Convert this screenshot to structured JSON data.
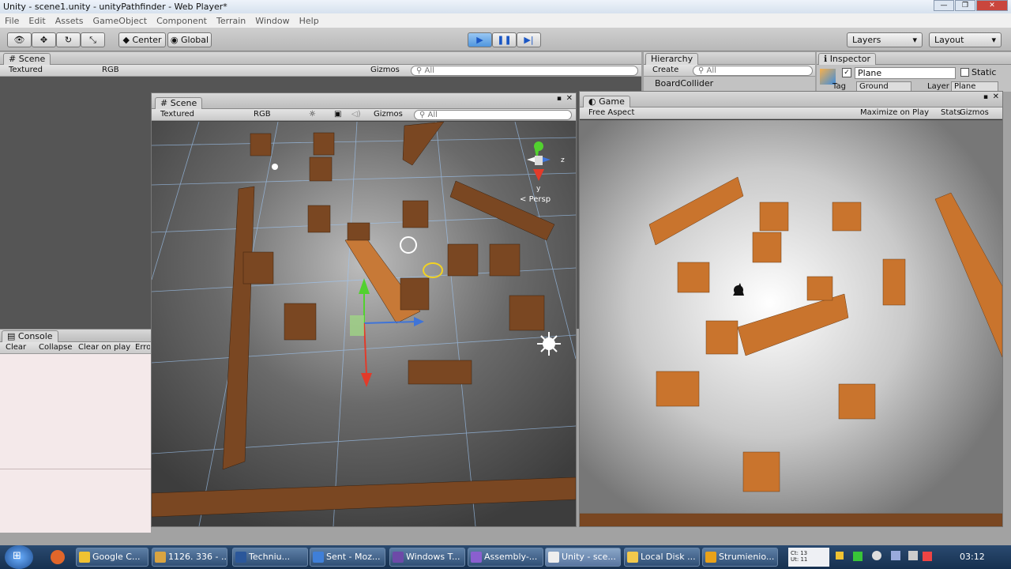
{
  "window": {
    "title": "Unity - scene1.unity - unityPathfinder - Web Player*"
  },
  "menu": [
    "File",
    "Edit",
    "Assets",
    "GameObject",
    "Component",
    "Terrain",
    "Window",
    "Help"
  ],
  "toolbar": {
    "center": "Center",
    "global": "Global",
    "layers": "Layers",
    "layout": "Layout"
  },
  "scene_bg": {
    "tab": "Scene",
    "shading": "Textured",
    "render": "RGB",
    "gizmos": "Gizmos",
    "search": "All"
  },
  "hierarchy": {
    "tab": "Hierarchy",
    "create": "Create",
    "search": "All",
    "item": "BoardCollider"
  },
  "inspector": {
    "tab": "Inspector",
    "name": "Plane",
    "static": "Static",
    "tag_label": "Tag",
    "tag": "Ground",
    "layer_label": "Layer",
    "layer": "Plane"
  },
  "scene": {
    "tab": "Scene",
    "shading": "Textured",
    "render": "RGB",
    "gizmos": "Gizmos",
    "search": "All",
    "persp": "Persp",
    "axis_y": "y",
    "axis_z": "z"
  },
  "game": {
    "tab": "Game",
    "aspect": "Free Aspect",
    "maximize": "Maximize on Play",
    "stats": "Stats",
    "gizmos": "Gizmos"
  },
  "console": {
    "tab": "Console",
    "clear": "Clear",
    "collapse": "Collapse",
    "clear_on_play": "Clear on play",
    "error": "Erro"
  },
  "taskbar": {
    "items": [
      "Google C...",
      "1126. 336 - ...",
      "Techniu...",
      "Sent - Moz...",
      "Windows T...",
      "Assembly-...",
      "Unity - sce...",
      "Local Disk ...",
      "Strumienio..."
    ],
    "clock": "03:12",
    "tray_text": "Ct: 13\nUt: 11"
  }
}
